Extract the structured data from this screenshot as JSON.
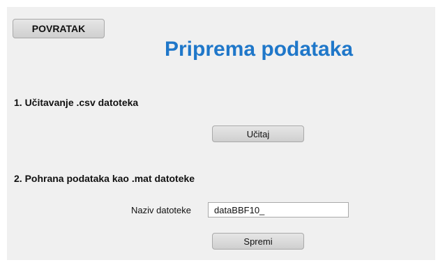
{
  "header": {
    "back_label": "POVRATAK",
    "title": "Priprema podataka"
  },
  "section1": {
    "heading": "1. Učitavanje .csv datoteka",
    "load_label": "Učitaj"
  },
  "section2": {
    "heading": "2. Pohrana podataka kao .mat datoteke",
    "filename_label": "Naziv datoteke",
    "filename_value": "dataBBF10_",
    "save_label": "Spremi"
  },
  "colors": {
    "title": "#1f77c9",
    "panel_bg": "#f0f0f0"
  }
}
